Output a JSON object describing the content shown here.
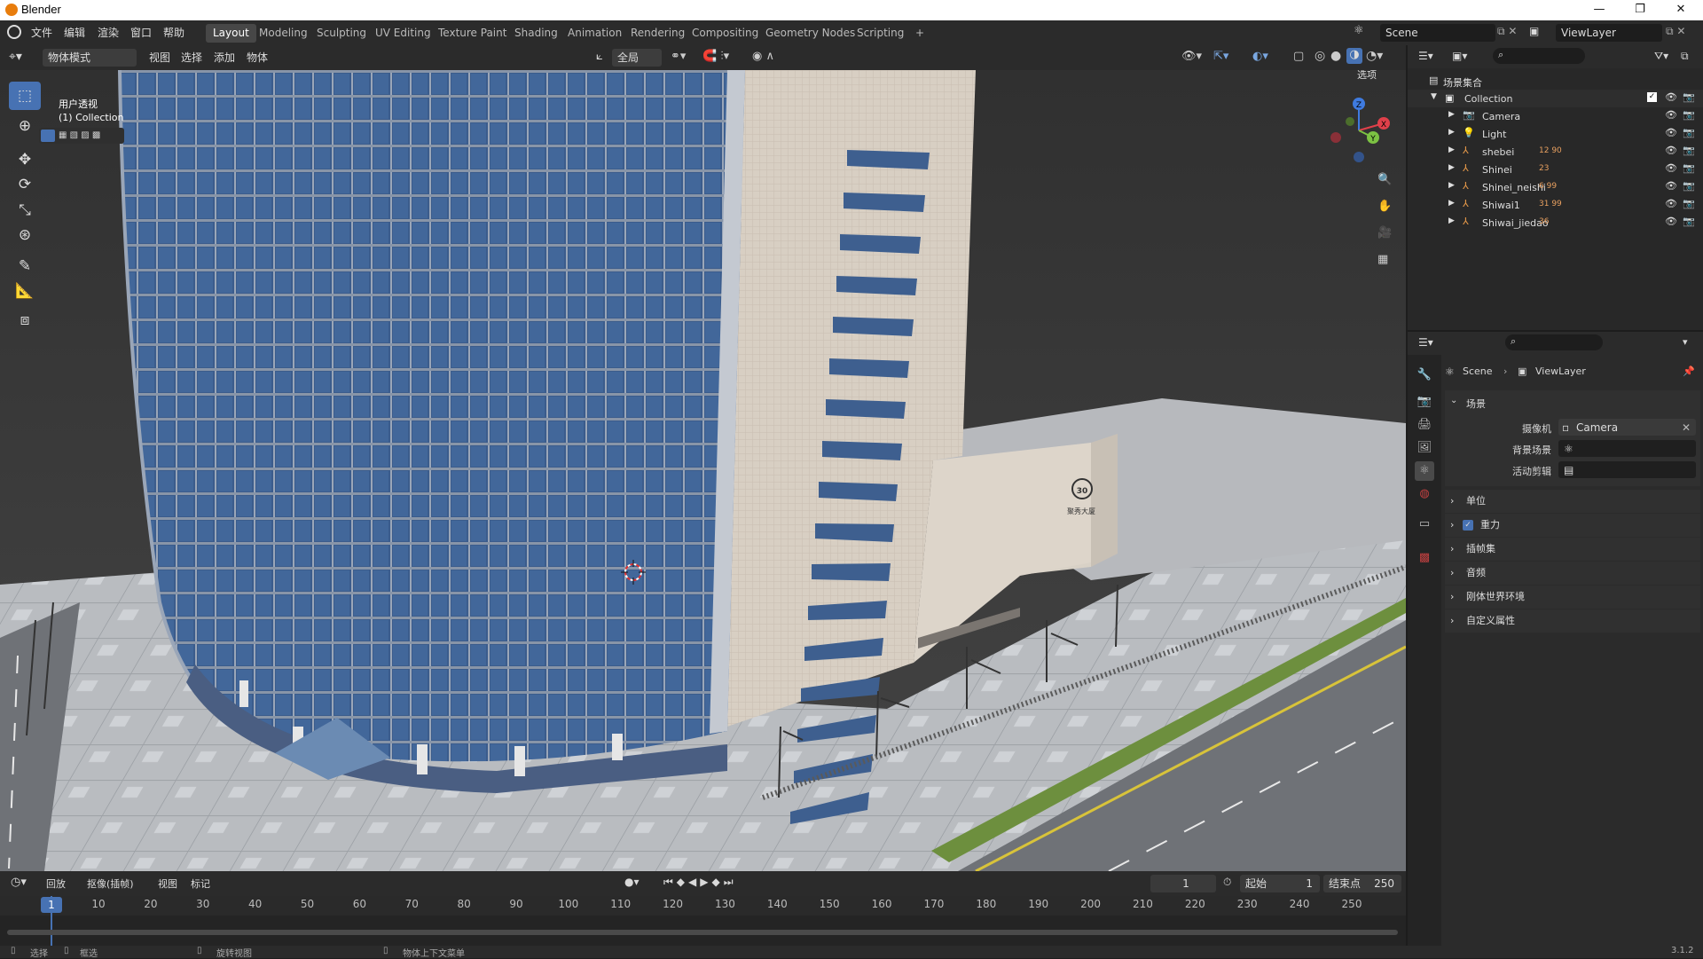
{
  "app": {
    "title": "Blender",
    "version": "3.1.2"
  },
  "menus": [
    "文件",
    "编辑",
    "渲染",
    "窗口",
    "帮助"
  ],
  "workspaces": [
    "Layout",
    "Modeling",
    "Sculpting",
    "UV Editing",
    "Texture Paint",
    "Shading",
    "Animation",
    "Rendering",
    "Compositing",
    "Geometry Nodes",
    "Scripting"
  ],
  "active_workspace": "Layout",
  "add_workspace": "+",
  "scene_name": "Scene",
  "view_layer_name": "ViewLayer",
  "viewport_header": {
    "mode": "物体模式",
    "menus": [
      "视图",
      "选择",
      "添加",
      "物体"
    ],
    "orientation": "全局",
    "options": "选项"
  },
  "viewport": {
    "view_label": "用户透视",
    "collection_label": "(1) Collection",
    "sign_text": "聚秀大厦"
  },
  "gizmo": {
    "x": "X",
    "y": "Y",
    "z": "Z"
  },
  "outliner": {
    "root": "场景集合",
    "collection": "Collection",
    "items": [
      {
        "name": "Camera",
        "badge": ""
      },
      {
        "name": "Light",
        "badge": ""
      },
      {
        "name": "shebei",
        "badge": "12 90"
      },
      {
        "name": "Shinei",
        "badge": "23"
      },
      {
        "name": "Shinei_neishi",
        "badge": "6 99"
      },
      {
        "name": "Shiwai1",
        "badge": "31 99"
      },
      {
        "name": "Shiwai_jiedao",
        "badge": "36"
      }
    ]
  },
  "properties": {
    "breadcrumb": [
      "Scene",
      "ViewLayer"
    ],
    "panel_title": "场景",
    "fields": [
      {
        "label": "摄像机",
        "value": "Camera"
      },
      {
        "label": "背景场景",
        "value": ""
      },
      {
        "label": "活动剪辑",
        "value": ""
      }
    ],
    "sections": [
      "单位",
      "重力",
      "插帧集",
      "音频",
      "刚体世界环境",
      "自定义属性"
    ]
  },
  "timeline": {
    "menus": [
      "回放",
      "抠像(插帧)",
      "视图",
      "标记"
    ],
    "current_frame": "1",
    "start_label": "起始",
    "start": "1",
    "end_label": "结束点",
    "end": "250",
    "ticks": [
      "1",
      "10",
      "20",
      "30",
      "40",
      "50",
      "60",
      "70",
      "80",
      "90",
      "100",
      "110",
      "120",
      "130",
      "140",
      "150",
      "160",
      "170",
      "180",
      "190",
      "200",
      "210",
      "220",
      "230",
      "240",
      "250"
    ]
  },
  "status": {
    "select": "选择",
    "box": "框选",
    "rotate": "旋转视图",
    "context": "物体上下文菜单"
  }
}
